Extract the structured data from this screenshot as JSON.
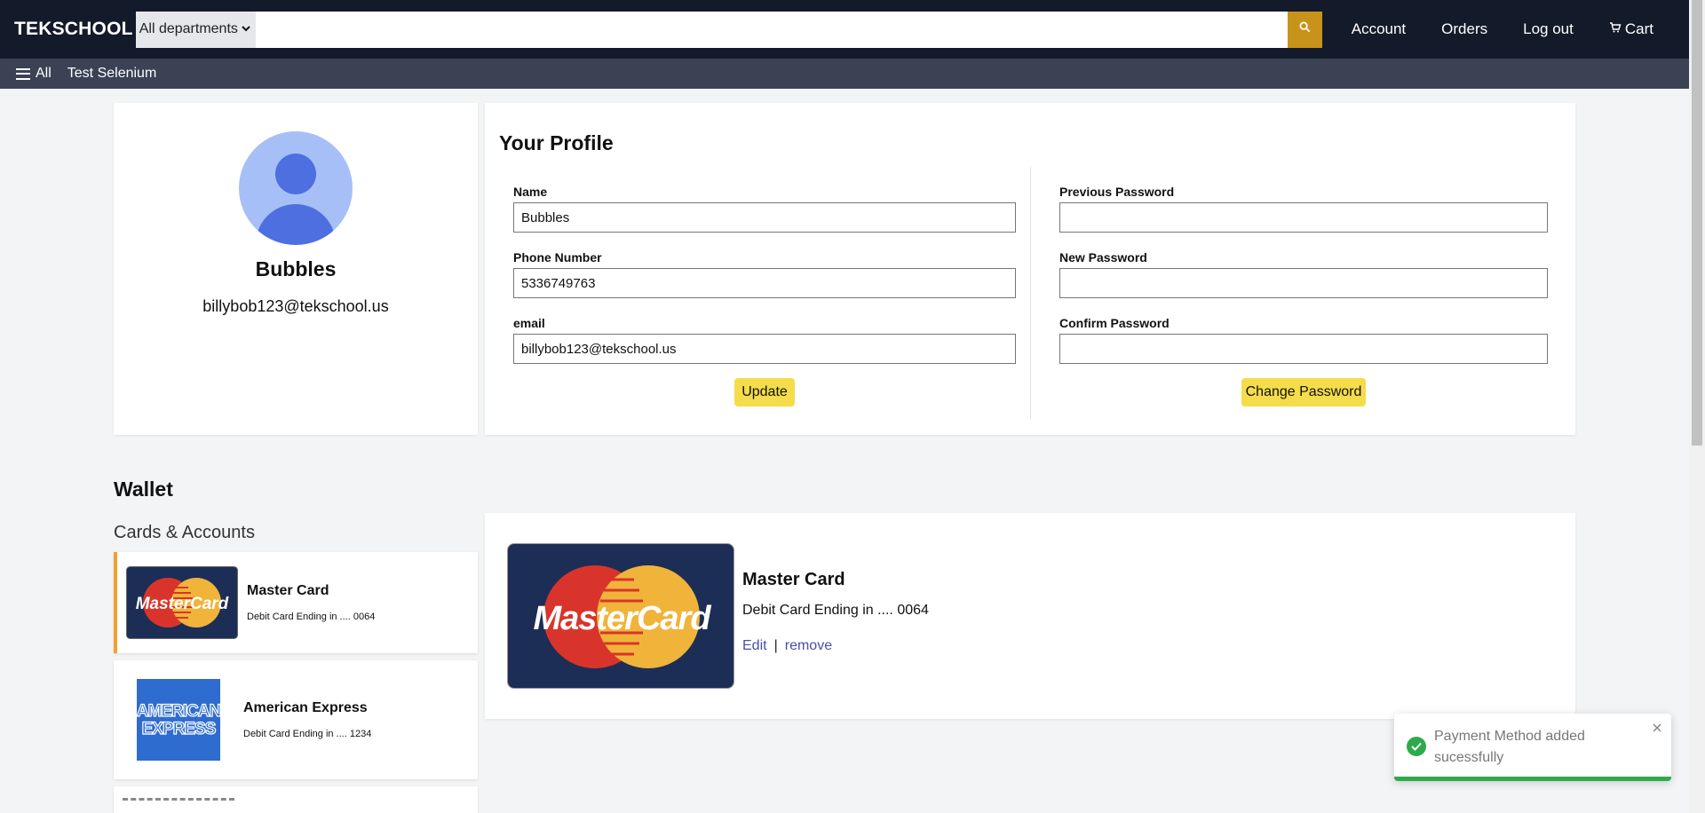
{
  "header": {
    "logo": "TEKSCHOOL",
    "department_selected": "All departments",
    "search_value": "",
    "nav": [
      "Account",
      "Orders",
      "Log out",
      "Cart"
    ]
  },
  "subnav": {
    "all_label": "All",
    "items": [
      "Test Selenium"
    ]
  },
  "profile": {
    "name": "Bubbles",
    "email": "billybob123@tekschool.us"
  },
  "your_profile": {
    "title": "Your Profile",
    "name_label": "Name",
    "name_value": "Bubbles",
    "phone_label": "Phone Number",
    "phone_value": "5336749763",
    "email_label": "email",
    "email_value": "billybob123@tekschool.us",
    "update_label": "Update",
    "prev_pw_label": "Previous Password",
    "new_pw_label": "New Password",
    "confirm_pw_label": "Confirm Password",
    "change_pw_label": "Change Password"
  },
  "wallet": {
    "title": "Wallet",
    "subtitle": "Cards & Accounts",
    "cards": [
      {
        "name": "Master Card",
        "desc": "Debit Card Ending in .... 0064",
        "logo": "MasterCard"
      },
      {
        "name": "American Express",
        "desc": "Debit Card Ending in .... 1234",
        "logo_top": "AMERICAN",
        "logo_bottom": "EXPRESS"
      }
    ]
  },
  "detail": {
    "logo": "MasterCard",
    "name": "Master Card",
    "desc": "Debit Card Ending in .... 0064",
    "edit": "Edit",
    "separator": "|",
    "remove": "remove"
  },
  "toast": {
    "message": "Payment Method added sucessfully"
  },
  "colors": {
    "header_bg": "#131a2a",
    "subnav_bg": "#3a4254",
    "accent": "#f5dc4a",
    "search_btn": "#c8931a",
    "success": "#2eaa4a"
  }
}
